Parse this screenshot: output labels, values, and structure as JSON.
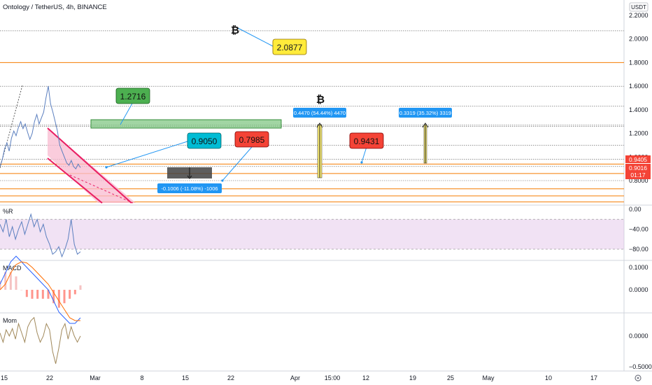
{
  "header": {
    "title": "Ontology / TetherUS, 4h, BINANCE",
    "currency": "USDT"
  },
  "colors": {
    "hline_red": "#f57c00",
    "hline_dark": "#555555",
    "channel": "#e91e63",
    "channel_fill": "#f8bbd0",
    "green_box": "#4caf50",
    "gray_box": "#424242",
    "yellow_arrow": "#fff176",
    "blue_label": "#2196f3",
    "cyan_label": "#00bcd4",
    "red_label": "#f44336",
    "green_label": "#4caf50",
    "yellow_label": "#ffeb3b",
    "price_line": "#f44336",
    "williams_line": "#5b7fbf",
    "macd_line": "#2962ff",
    "signal_line": "#ff6d00",
    "mom_line": "#a0885a"
  },
  "chart_data": [
    {
      "type": "line",
      "pane": "price",
      "title": "Ontology / TetherUS, 4h, BINANCE",
      "ylabel": "USDT",
      "ylim": [
        0.6,
        2.2
      ],
      "yticks": [
        "2.2000",
        "2.0000",
        "1.8000",
        "1.6000",
        "1.4000",
        "1.2000",
        "1.0000",
        "0.8000"
      ],
      "x_labels": [
        "15",
        "22",
        "Mar",
        "8",
        "15",
        "22",
        "Apr",
        "15:00",
        "12",
        "19",
        "25",
        "May",
        "10",
        "17"
      ],
      "price_series": [
        0.92,
        0.98,
        1.07,
        1.12,
        1.05,
        1.16,
        1.22,
        1.18,
        1.25,
        1.3,
        1.24,
        1.28,
        1.21,
        1.15,
        1.2,
        1.3,
        1.36,
        1.28,
        1.33,
        1.38,
        1.5,
        1.6,
        1.45,
        1.38,
        1.3,
        1.22,
        1.1,
        1.05,
        1.0,
        0.95,
        0.93,
        0.97,
        0.92,
        0.9,
        0.94,
        0.91
      ],
      "horizontal_levels": [
        2.07,
        1.8,
        1.6,
        1.43,
        1.27,
        1.26,
        1.1,
        0.98,
        0.94,
        0.92,
        0.86,
        0.8,
        0.73,
        0.67,
        0.62
      ],
      "current_price": "0.9405",
      "price_tags": [
        "0.9016",
        "01:17"
      ],
      "labels": [
        "2.0877",
        "1.2716",
        "0.9050",
        "0.7985",
        "0.9431"
      ],
      "measure_labels": [
        "0.4470 (54.44%) 4470",
        "0.3319 (35.32%) 3319",
        "-0.1006 (-11.08%) -1006"
      ],
      "icons": [
        "bitcoin-icon",
        "bitcoin-icon"
      ]
    },
    {
      "type": "line",
      "pane": "williams",
      "title": "%R",
      "ylim": [
        -100,
        0
      ],
      "yticks": [
        "0.00",
        "−40.00",
        "−80.00"
      ],
      "bands": [
        -20,
        -80
      ],
      "values": [
        -30,
        -45,
        -20,
        -55,
        -35,
        -60,
        -40,
        -25,
        -50,
        -30,
        -10,
        -35,
        -20,
        -45,
        -30,
        -55,
        -70,
        -90,
        -85,
        -75,
        -95,
        -80,
        -60,
        -20,
        -70,
        -90,
        -85
      ]
    },
    {
      "type": "line",
      "pane": "macd",
      "title": "MACD",
      "ylim": [
        -0.1,
        0.1
      ],
      "yticks": [
        "0.1000",
        "0.0000"
      ],
      "macd": [
        0.01,
        0.03,
        0.05,
        0.06,
        0.05,
        0.04,
        0.03,
        0.02,
        0.01,
        0.0,
        -0.02,
        -0.04,
        -0.05,
        -0.06,
        -0.06,
        -0.05
      ],
      "signal": [
        0.0,
        0.01,
        0.03,
        0.045,
        0.05,
        0.048,
        0.04,
        0.03,
        0.02,
        0.01,
        -0.005,
        -0.02,
        -0.035,
        -0.05,
        -0.055,
        -0.055
      ],
      "histogram": [
        0.01,
        0.02,
        0.02,
        0.015,
        0.0,
        -0.008,
        -0.01,
        -0.01,
        -0.01,
        -0.01,
        -0.015,
        -0.02,
        -0.015,
        -0.01,
        -0.005,
        0.005
      ]
    },
    {
      "type": "line",
      "pane": "momentum",
      "title": "Mom",
      "ylim": [
        -0.5,
        0.5
      ],
      "yticks": [
        "0.0000",
        "−0.5000"
      ],
      "values": [
        0.05,
        -0.1,
        0.1,
        0.0,
        0.12,
        -0.05,
        0.2,
        0.05,
        -0.1,
        0.15,
        0.25,
        0.3,
        0.05,
        -0.1,
        0.0,
        0.2,
        0.1,
        -0.25,
        -0.45,
        -0.2,
        0.1,
        0.2,
        -0.05,
        0.15,
        0.0,
        -0.1,
        0.0
      ]
    }
  ]
}
